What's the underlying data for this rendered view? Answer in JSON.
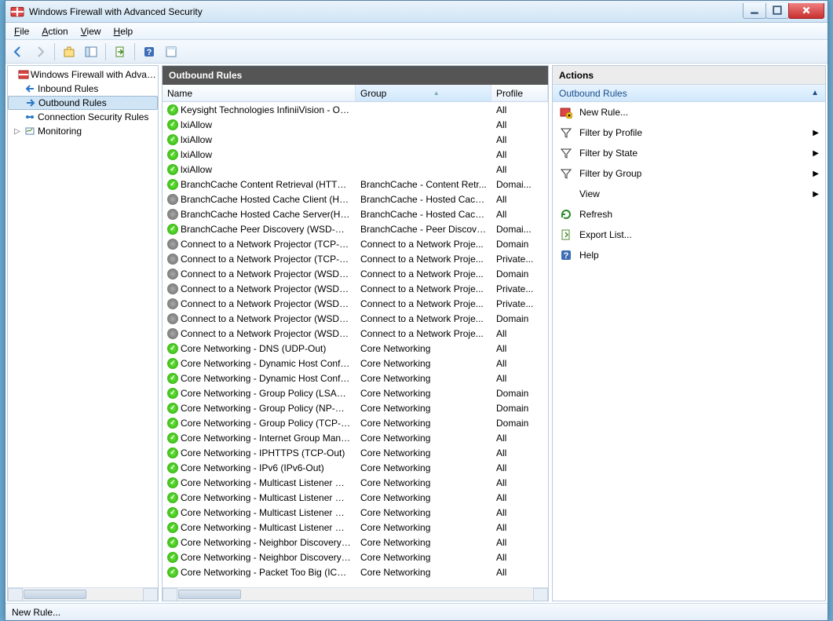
{
  "window": {
    "title": "Windows Firewall with Advanced Security"
  },
  "menu": {
    "file": "File",
    "action": "Action",
    "view": "View",
    "help": "Help"
  },
  "tree": {
    "root": "Windows Firewall with Advanced Security",
    "inbound": "Inbound Rules",
    "outbound": "Outbound Rules",
    "connsec": "Connection Security Rules",
    "monitoring": "Monitoring"
  },
  "center": {
    "title": "Outbound Rules",
    "columns": {
      "name": "Name",
      "group": "Group",
      "profile": "Profile"
    },
    "rules": [
      {
        "enabled": true,
        "name": "Keysight Technologies InfiniiVision - Out...",
        "group": "",
        "profile": "All"
      },
      {
        "enabled": true,
        "name": "lxiAllow",
        "group": "",
        "profile": "All"
      },
      {
        "enabled": true,
        "name": "lxiAllow",
        "group": "",
        "profile": "All"
      },
      {
        "enabled": true,
        "name": "lxiAllow",
        "group": "",
        "profile": "All"
      },
      {
        "enabled": true,
        "name": "lxiAllow",
        "group": "",
        "profile": "All"
      },
      {
        "enabled": true,
        "name": "BranchCache Content Retrieval (HTTP-O...",
        "group": "BranchCache - Content Retr...",
        "profile": "Domai..."
      },
      {
        "enabled": false,
        "name": "BranchCache Hosted Cache Client (HTT...",
        "group": "BranchCache - Hosted Cach...",
        "profile": "All"
      },
      {
        "enabled": false,
        "name": "BranchCache Hosted Cache Server(HTTP...",
        "group": "BranchCache - Hosted Cach...",
        "profile": "All"
      },
      {
        "enabled": true,
        "name": "BranchCache Peer Discovery (WSD-Out)",
        "group": "BranchCache - Peer Discove...",
        "profile": "Domai..."
      },
      {
        "enabled": false,
        "name": "Connect to a Network Projector (TCP-Out)",
        "group": "Connect to a Network Proje...",
        "profile": "Domain"
      },
      {
        "enabled": false,
        "name": "Connect to a Network Projector (TCP-Out)",
        "group": "Connect to a Network Proje...",
        "profile": "Private..."
      },
      {
        "enabled": false,
        "name": "Connect to a Network Projector (WSD Ev...",
        "group": "Connect to a Network Proje...",
        "profile": "Domain"
      },
      {
        "enabled": false,
        "name": "Connect to a Network Projector (WSD Ev...",
        "group": "Connect to a Network Proje...",
        "profile": "Private..."
      },
      {
        "enabled": false,
        "name": "Connect to a Network Projector (WSD Ev...",
        "group": "Connect to a Network Proje...",
        "profile": "Private..."
      },
      {
        "enabled": false,
        "name": "Connect to a Network Projector (WSD Ev...",
        "group": "Connect to a Network Proje...",
        "profile": "Domain"
      },
      {
        "enabled": false,
        "name": "Connect to a Network Projector (WSD-O...",
        "group": "Connect to a Network Proje...",
        "profile": "All"
      },
      {
        "enabled": true,
        "name": "Core Networking - DNS (UDP-Out)",
        "group": "Core Networking",
        "profile": "All"
      },
      {
        "enabled": true,
        "name": "Core Networking - Dynamic Host Config...",
        "group": "Core Networking",
        "profile": "All"
      },
      {
        "enabled": true,
        "name": "Core Networking - Dynamic Host Config...",
        "group": "Core Networking",
        "profile": "All"
      },
      {
        "enabled": true,
        "name": "Core Networking - Group Policy (LSASS-...",
        "group": "Core Networking",
        "profile": "Domain"
      },
      {
        "enabled": true,
        "name": "Core Networking - Group Policy (NP-Out)",
        "group": "Core Networking",
        "profile": "Domain"
      },
      {
        "enabled": true,
        "name": "Core Networking - Group Policy (TCP-O...",
        "group": "Core Networking",
        "profile": "Domain"
      },
      {
        "enabled": true,
        "name": "Core Networking - Internet Group Mana...",
        "group": "Core Networking",
        "profile": "All"
      },
      {
        "enabled": true,
        "name": "Core Networking - IPHTTPS (TCP-Out)",
        "group": "Core Networking",
        "profile": "All"
      },
      {
        "enabled": true,
        "name": "Core Networking - IPv6 (IPv6-Out)",
        "group": "Core Networking",
        "profile": "All"
      },
      {
        "enabled": true,
        "name": "Core Networking - Multicast Listener Do...",
        "group": "Core Networking",
        "profile": "All"
      },
      {
        "enabled": true,
        "name": "Core Networking - Multicast Listener Qu...",
        "group": "Core Networking",
        "profile": "All"
      },
      {
        "enabled": true,
        "name": "Core Networking - Multicast Listener Rep...",
        "group": "Core Networking",
        "profile": "All"
      },
      {
        "enabled": true,
        "name": "Core Networking - Multicast Listener Rep...",
        "group": "Core Networking",
        "profile": "All"
      },
      {
        "enabled": true,
        "name": "Core Networking - Neighbor Discovery A...",
        "group": "Core Networking",
        "profile": "All"
      },
      {
        "enabled": true,
        "name": "Core Networking - Neighbor Discovery S...",
        "group": "Core Networking",
        "profile": "All"
      },
      {
        "enabled": true,
        "name": "Core Networking - Packet Too Big (ICMP...",
        "group": "Core Networking",
        "profile": "All"
      }
    ]
  },
  "actions": {
    "title": "Actions",
    "subtitle": "Outbound Rules",
    "items": [
      {
        "icon": "new-rule",
        "label": "New Rule...",
        "arrow": false
      },
      {
        "icon": "filter",
        "label": "Filter by Profile",
        "arrow": true
      },
      {
        "icon": "filter",
        "label": "Filter by State",
        "arrow": true
      },
      {
        "icon": "filter",
        "label": "Filter by Group",
        "arrow": true
      },
      {
        "icon": "none",
        "label": "View",
        "arrow": true
      },
      {
        "icon": "refresh",
        "label": "Refresh",
        "arrow": false
      },
      {
        "icon": "export",
        "label": "Export List...",
        "arrow": false
      },
      {
        "icon": "help",
        "label": "Help",
        "arrow": false
      }
    ]
  },
  "status": {
    "text": "New Rule..."
  }
}
